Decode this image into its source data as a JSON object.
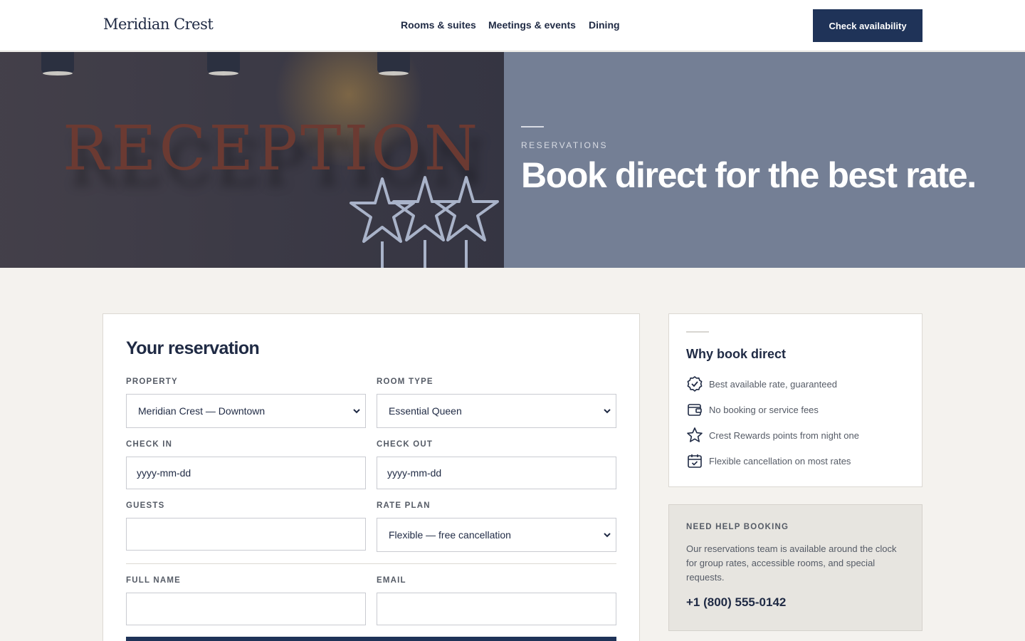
{
  "header": {
    "brand": "Meridian Crest",
    "nav": [
      "Rooms & suites",
      "Meetings & events",
      "Dining"
    ],
    "cta_label": "Check availability"
  },
  "hero": {
    "image_sign_text": "RECEPTION",
    "eyebrow": "RESERVATIONS",
    "title": "Book direct for the best rate."
  },
  "form": {
    "title": "Your reservation",
    "property": {
      "label": "PROPERTY",
      "value": "Meridian Crest — Downtown"
    },
    "room_type": {
      "label": "ROOM TYPE",
      "value": "Essential Queen"
    },
    "check_in": {
      "label": "CHECK IN",
      "placeholder": "yyyy-mm-dd"
    },
    "check_out": {
      "label": "CHECK OUT",
      "placeholder": "yyyy-mm-dd"
    },
    "guests": {
      "label": "GUESTS",
      "value": ""
    },
    "rate_plan": {
      "label": "RATE PLAN",
      "value": "Flexible — free cancellation"
    },
    "full_name": {
      "label": "FULL NAME",
      "value": ""
    },
    "email": {
      "label": "EMAIL",
      "value": ""
    }
  },
  "why": {
    "title": "Why book direct",
    "items": [
      {
        "icon": "badge-check-icon",
        "text": "Best available rate, guaranteed"
      },
      {
        "icon": "wallet-icon",
        "text": "No booking or service fees"
      },
      {
        "icon": "star-icon",
        "text": "Crest Rewards points from night one"
      },
      {
        "icon": "calendar-check-icon",
        "text": "Flexible cancellation on most rates"
      }
    ]
  },
  "help": {
    "label": "NEED HELP BOOKING",
    "text": "Our reservations team is available around the clock for group rates, accessible rooms, and special requests.",
    "phone": "+1 (800) 555-0142"
  },
  "colors": {
    "navy": "#1f3358",
    "hero_panel": "#747f95",
    "page_bg": "#f4f2ee"
  }
}
